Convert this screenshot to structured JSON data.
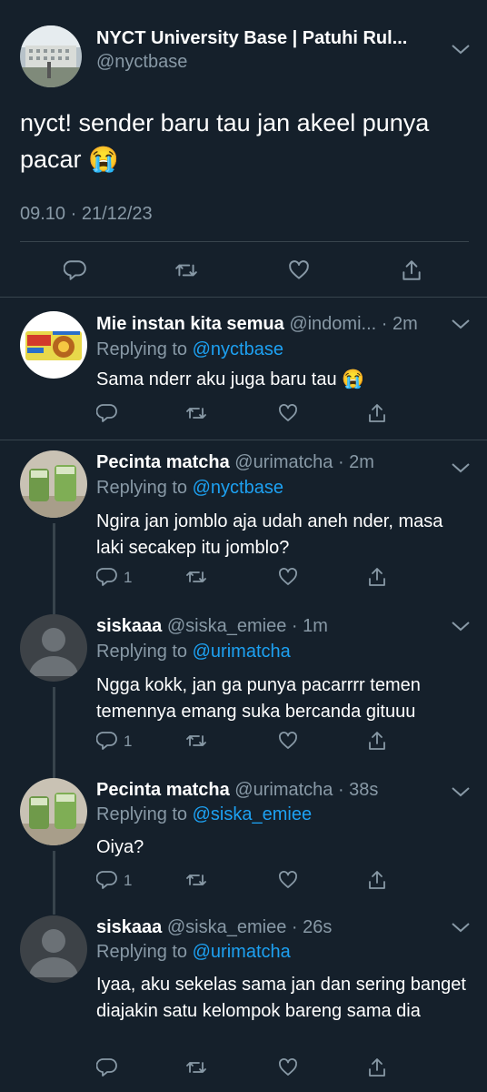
{
  "main_tweet": {
    "display_name": "NYCT University Base | Patuhi Rul...",
    "handle": "@nyctbase",
    "text": "nyct! sender baru tau jan akeel punya pacar 😭",
    "timestamp": "09.10 · 21/12/23"
  },
  "replies": [
    {
      "display_name": "Mie instan kita semua",
      "handle_time": "@indomi... · 2m",
      "replying_label": "Replying to",
      "replying_to": "@nyctbase",
      "text": "Sama nderr aku juga baru tau 😭",
      "reply_count": ""
    },
    {
      "display_name": "Pecinta matcha",
      "handle_time": "@urimatcha · 2m",
      "replying_label": "Replying to",
      "replying_to": "@nyctbase",
      "text": "Ngira jan jomblo aja udah aneh nder, masa laki secakep itu jomblo?",
      "reply_count": "1"
    },
    {
      "display_name": "siskaaa",
      "handle_time": "@siska_emiee · 1m",
      "replying_label": "Replying to",
      "replying_to": "@urimatcha",
      "text": "Ngga kokk, jan ga punya pacarrrr temen temennya emang suka bercanda gituuu",
      "reply_count": "1"
    },
    {
      "display_name": "Pecinta matcha",
      "handle_time": "@urimatcha · 38s",
      "replying_label": "Replying to",
      "replying_to": "@siska_emiee",
      "text": "Oiya?",
      "reply_count": "1"
    },
    {
      "display_name": "siskaaa",
      "handle_time": "@siska_emiee · 26s",
      "replying_label": "Replying to",
      "replying_to": "@urimatcha",
      "text": "Iyaa, aku sekelas sama jan dan sering banget diajakin satu kelompok bareng sama dia",
      "reply_count": ""
    }
  ],
  "colors": {
    "background": "#15202b",
    "muted": "#8899a6",
    "accent": "#1da1f2",
    "divider": "#38444d"
  },
  "icons": [
    "reply-icon",
    "retweet-icon",
    "like-icon",
    "share-icon",
    "chevron-down-icon"
  ]
}
